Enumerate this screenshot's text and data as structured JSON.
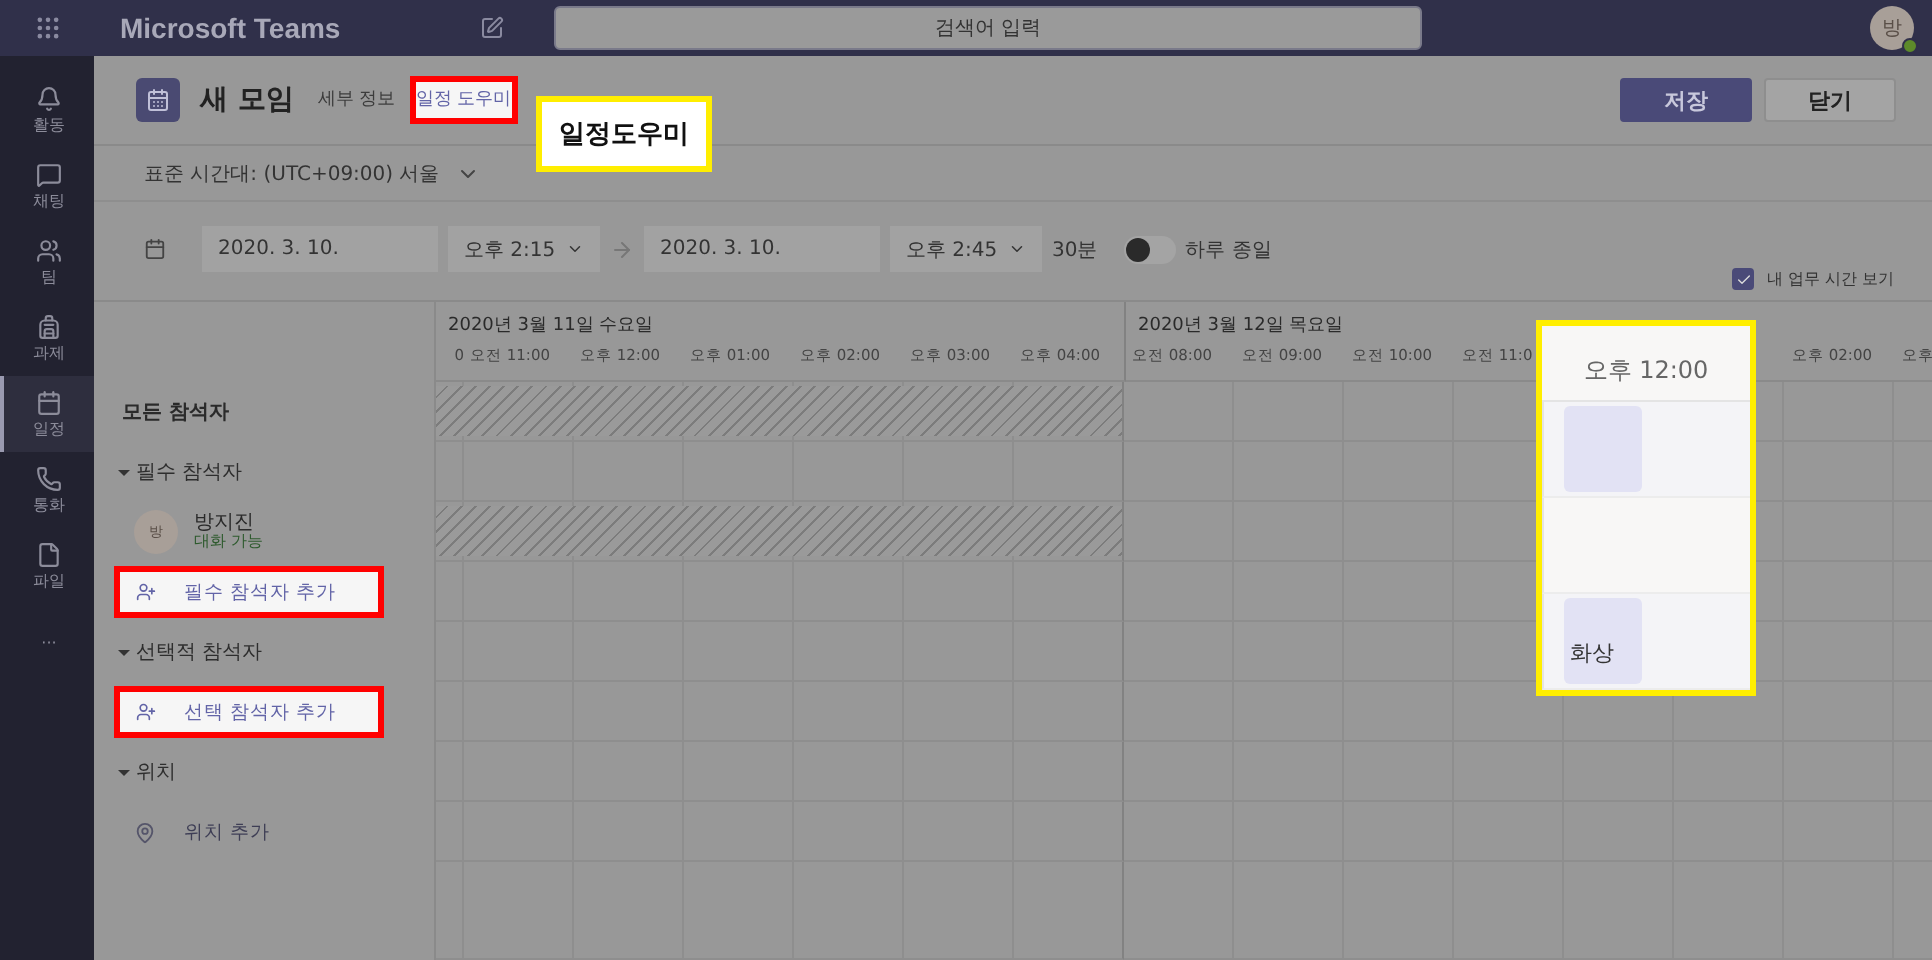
{
  "app": {
    "title": "Microsoft Teams",
    "search_placeholder": "검색어 입력",
    "avatar": "방"
  },
  "rail": [
    {
      "label": "활동",
      "selected": false
    },
    {
      "label": "채팅",
      "selected": false
    },
    {
      "label": "팀",
      "selected": false
    },
    {
      "label": "과제",
      "selected": false
    },
    {
      "label": "일정",
      "selected": true
    },
    {
      "label": "통화",
      "selected": false
    },
    {
      "label": "파일",
      "selected": false
    },
    {
      "label": "···",
      "selected": false
    }
  ],
  "meeting": {
    "title": "새 모임",
    "tabs": [
      {
        "label": "세부 정보",
        "selected": false,
        "highlighted": false
      },
      {
        "label": "일정 도우미",
        "selected": true,
        "highlighted": true
      }
    ],
    "buttons": [
      {
        "label": "저장",
        "kind": "primary"
      },
      {
        "label": "닫기",
        "kind": "secondary"
      }
    ],
    "timezone": "표준 시간대: (UTC+09:00) 서울",
    "start_date": "2020. 3. 10.",
    "start_time": "오후 2:15",
    "end_date": "2020. 3. 10.",
    "end_time": "오후 2:45",
    "duration": "30분",
    "all_day": {
      "label": "하루 종일",
      "on": false
    },
    "work_hours": {
      "label": "내 업무 시간 보기",
      "checked": true
    }
  },
  "scheduler": {
    "days": [
      {
        "label": "2020년 3월 11일 수요일",
        "slots": [
          {
            "label": "0"
          },
          {
            "label": "오전 11:00"
          },
          {
            "label": "오후 12:00"
          },
          {
            "label": "오후 01:00"
          },
          {
            "label": "오후 02:00"
          },
          {
            "label": "오후 03:00"
          },
          {
            "label": "오후 04:00"
          }
        ]
      },
      {
        "label": "2020년 3월 12일 목요일",
        "slots": [
          {
            "label": "오전 08:00"
          },
          {
            "label": "오전 09:00"
          },
          {
            "label": "오전 10:00"
          },
          {
            "label": "오전 11:0"
          },
          {
            "label": "오후 02:00"
          },
          {
            "label": "오후"
          }
        ]
      }
    ],
    "rows": [
      {
        "kind": "header",
        "label": "모든 참석자",
        "hatched": true
      },
      {
        "kind": "group",
        "label": "필수 참석자",
        "hatched": false
      },
      {
        "kind": "person",
        "label": "방지진",
        "avatar": "방",
        "status": "대화 가능",
        "hatched": true
      },
      {
        "kind": "add",
        "label": "필수 참석자 추가",
        "highlighted": true,
        "hatched": false
      },
      {
        "kind": "group",
        "label": "선택적 참석자",
        "hatched": false
      },
      {
        "kind": "add",
        "label": "선택 참석자 추가",
        "highlighted": true,
        "hatched": false
      },
      {
        "kind": "group",
        "label": "위치",
        "hatched": false
      },
      {
        "kind": "location",
        "label": "위치 추가",
        "hatched": false
      }
    ]
  },
  "annotations": {
    "label": "일정도우미",
    "magnifier": {
      "time": "오후 12:00",
      "rows": [
        {
          "busy": true
        },
        {
          "busy": false
        },
        {
          "busy": true,
          "text": "화상"
        }
      ]
    }
  }
}
